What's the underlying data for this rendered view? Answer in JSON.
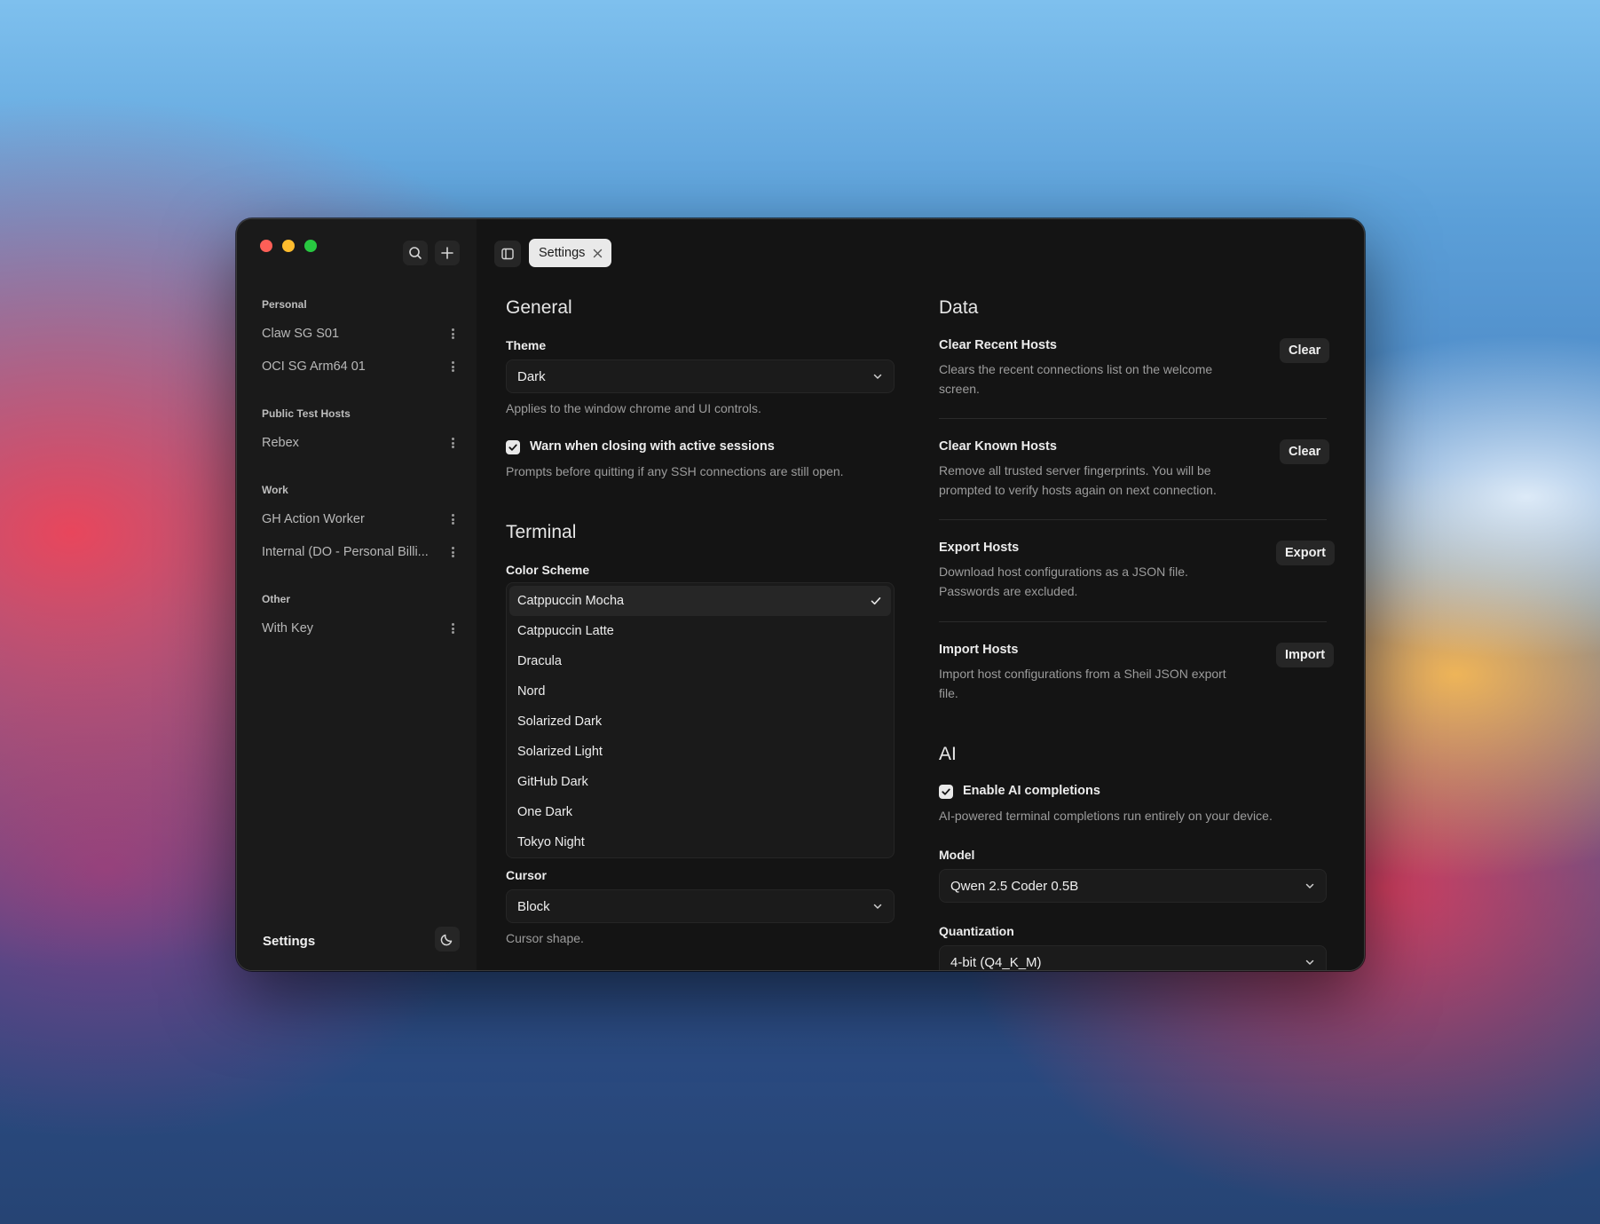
{
  "window": {
    "tab_title": "Settings"
  },
  "sidebar": {
    "groups": [
      {
        "label": "Personal",
        "hosts": [
          "Claw SG S01",
          "OCI SG Arm64 01"
        ]
      },
      {
        "label": "Public Test Hosts",
        "hosts": [
          "Rebex"
        ]
      },
      {
        "label": "Work",
        "hosts": [
          "GH Action Worker",
          "Internal (DO - Personal Billi..."
        ]
      },
      {
        "label": "Other",
        "hosts": [
          "With Key"
        ]
      }
    ],
    "footer_label": "Settings",
    "icons": [
      "search-icon",
      "plus-icon",
      "kebab-icon",
      "moon-icon"
    ]
  },
  "general": {
    "title": "General",
    "theme_label": "Theme",
    "theme_value": "Dark",
    "theme_help": "Applies to the window chrome and UI controls.",
    "warn_label": "Warn when closing with active sessions",
    "warn_checked": true,
    "warn_help": "Prompts before quitting if any SSH connections are still open."
  },
  "terminal": {
    "title": "Terminal",
    "scheme_label": "Color Scheme",
    "schemes": [
      "Catppuccin Mocha",
      "Catppuccin Latte",
      "Dracula",
      "Nord",
      "Solarized Dark",
      "Solarized Light",
      "GitHub Dark",
      "One Dark",
      "Tokyo Night"
    ],
    "selected_scheme": "Catppuccin Mocha",
    "cursor_label": "Cursor",
    "cursor_value": "Block",
    "cursor_help": "Cursor shape."
  },
  "data": {
    "title": "Data",
    "items": [
      {
        "title": "Clear Recent Hosts",
        "desc": "Clears the recent connections list on the welcome screen.",
        "button": "Clear"
      },
      {
        "title": "Clear Known Hosts",
        "desc": "Remove all trusted server fingerprints. You will be prompted to verify hosts again on next connection.",
        "button": "Clear"
      },
      {
        "title": "Export Hosts",
        "desc": "Download host configurations as a JSON file. Passwords are excluded.",
        "button": "Export"
      },
      {
        "title": "Import Hosts",
        "desc": "Import host configurations from a Sheil JSON export file.",
        "button": "Import"
      }
    ]
  },
  "ai": {
    "title": "AI",
    "enable_label": "Enable AI completions",
    "enable_checked": true,
    "enable_help": "AI-powered terminal completions run entirely on your device.",
    "model_label": "Model",
    "model_value": "Qwen 2.5 Coder 0.5B",
    "quant_label": "Quantization",
    "quant_value": "4-bit (Q4_K_M)"
  },
  "colors": {
    "close": "#fe5f57",
    "minimize": "#febc2e",
    "zoom": "#28c840",
    "window_bg": "#161616",
    "sidebar_bg": "#1a1a1a"
  }
}
